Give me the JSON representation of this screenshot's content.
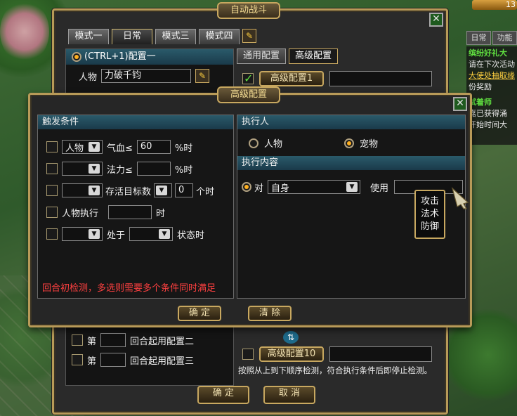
{
  "hud": {
    "level": "13",
    "tabs": [
      "日常",
      "功能"
    ],
    "lines": [
      "缤纷好礼大",
      "请在下次活动",
      "大使处抽取缘",
      "份奖励",
      "试着师",
      "嘉已获得涌",
      "开始时间大"
    ]
  },
  "main_window": {
    "title": "自动战斗",
    "tabs": [
      "模式一",
      "日常",
      "模式三",
      "模式四"
    ],
    "active_tab": 1,
    "config_header": "(CTRL+1)配置一",
    "character_label": "人物",
    "character_value": "力破千钧",
    "sub_tabs": [
      "通用配置",
      "高级配置"
    ],
    "active_sub_tab": 1,
    "adv_config_first": "高级配置1",
    "adv_config_last": "高级配置10",
    "round_prefix": "第",
    "round_rows": [
      "回合起用配置二",
      "回合起用配置三"
    ],
    "hint": "按照从上到下顺序检测，符合执行条件后即停止检测。",
    "confirm_label": "确 定",
    "cancel_label": "取 消",
    "swap_icon": "⇅"
  },
  "adv_window": {
    "title": "高级配置",
    "trigger_title": "触发条件",
    "conditions": [
      {
        "select": "人物",
        "label": "气血≤",
        "value": "60",
        "suffix": "%时"
      },
      {
        "select": "",
        "label": "法力≤",
        "value": "",
        "suffix": "%时"
      },
      {
        "select": "",
        "label": "存活目标数",
        "value": "0",
        "suffix": "个时"
      },
      {
        "label": "人物执行",
        "value": "",
        "suffix": "时"
      },
      {
        "select": "",
        "label": "处于",
        "value": "",
        "suffix": "状态时"
      }
    ],
    "warning": "回合初检测，多选则需要多个条件同时满足",
    "executor_title": "执行人",
    "executor_options": [
      "人物",
      "宠物"
    ],
    "executor_selected": 1,
    "content_title": "执行内容",
    "target_prefix": "对",
    "target_value": "自身",
    "use_label": "使用",
    "skill_menu": [
      "攻击",
      "法术",
      "防御"
    ],
    "confirm_label": "确 定",
    "clear_label": "清 除"
  }
}
